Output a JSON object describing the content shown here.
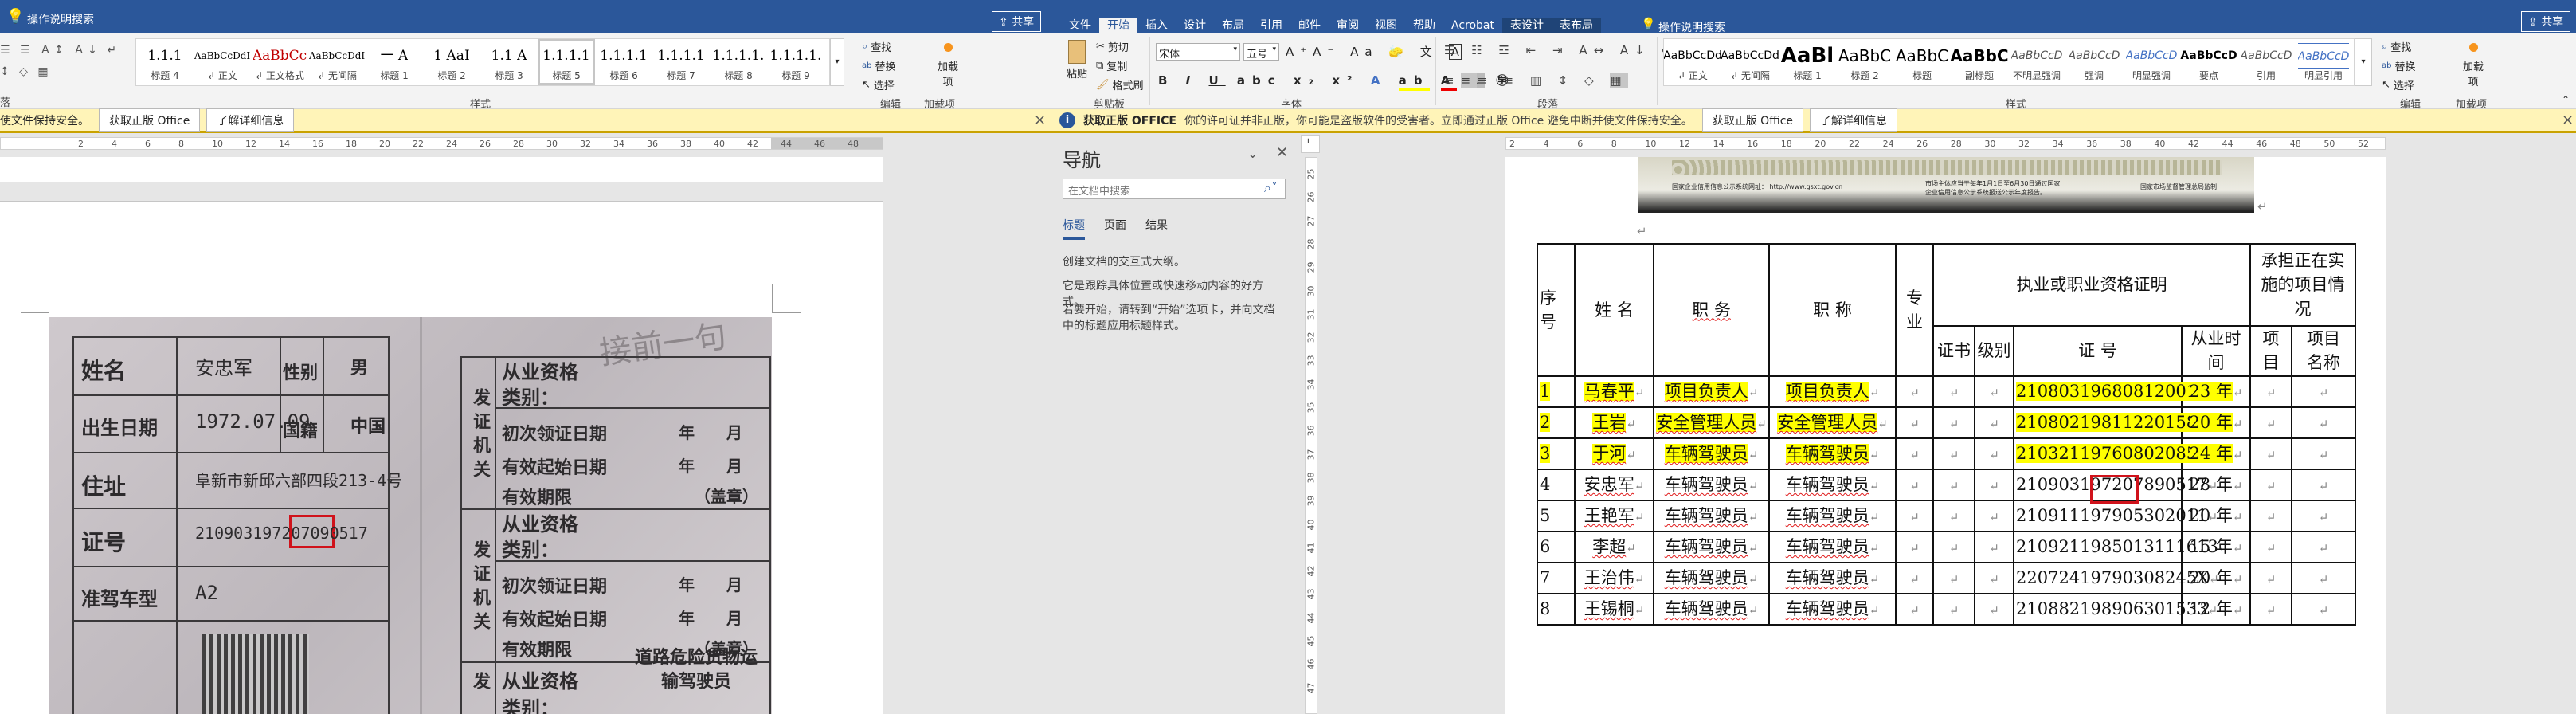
{
  "left_window": {
    "search_label": "操作说明搜索",
    "share_label": "共享",
    "paragraph_group_label": "落",
    "styles": [
      {
        "preview": "1.1.1",
        "label": "标题 4"
      },
      {
        "preview": "AaBbCcDdI",
        "label": "↲ 正文"
      },
      {
        "preview": "AaBbCc",
        "label": "↲ 正文格式"
      },
      {
        "preview": "AaBbCcDdI",
        "label": "↲ 无间隔"
      },
      {
        "preview": "一  A",
        "label": "标题 1"
      },
      {
        "preview": "1  AaI",
        "label": "标题 2"
      },
      {
        "preview": "1.1  A",
        "label": "标题 3"
      },
      {
        "preview": "1.1.1.1",
        "label": "标题 5"
      },
      {
        "preview": "1.1.1.1",
        "label": "标题 6"
      },
      {
        "preview": "1.1.1.1",
        "label": "标题 7"
      },
      {
        "preview": "1.1.1.1.",
        "label": "标题 8"
      },
      {
        "preview": "1.1.1.1.",
        "label": "标题 9"
      }
    ],
    "selected_style": "标题 5",
    "styles_group_label": "样式",
    "editing": {
      "find": "查找",
      "replace": "替换",
      "select": "选择",
      "label": "编辑"
    },
    "addins": {
      "button": "加载项",
      "label": "加载项"
    },
    "infobar": {
      "message_tail": "使文件保持安全。",
      "get_button": "获取正版 Office",
      "learn_button": "了解详细信息",
      "close": "×"
    },
    "ruler_labels": [
      "2",
      "4",
      "6",
      "8",
      "10",
      "12",
      "14",
      "16",
      "18",
      "20",
      "22",
      "24",
      "26",
      "28",
      "30",
      "32",
      "34",
      "36",
      "38",
      "40",
      "42",
      "44",
      "46",
      "48"
    ],
    "photo": {
      "left_rows": [
        {
          "label": "姓名",
          "value": "安忠军",
          "extra_label": "性别",
          "extra_value": "男"
        },
        {
          "label": "出生日期",
          "value": "1972.07.09",
          "extra_label": "国籍",
          "extra_value": "中国"
        },
        {
          "label": "住址",
          "value": "阜新市新邱六部四段213-4号"
        },
        {
          "label": "证号",
          "value": "210903197207090517"
        },
        {
          "label": "准驾车型",
          "value": "A2"
        }
      ],
      "right_blocks": [
        {
          "issuer": "发证机关",
          "category": "从业资格\n类别：",
          "first_date": "初次领证日期",
          "start_date": "有效起始日期",
          "valid": "有效期限",
          "seal": "（盖章）",
          "ymd": "年　　月　　日"
        },
        {
          "issuer": "发证机关",
          "category": "从业资格\n类别：",
          "first_date": "初次领证日期",
          "start_date": "有效起始日期",
          "valid": "有效期限",
          "seal": "（盖章）",
          "ymd": "年　　月　　日"
        }
      ],
      "third_category": "从业资格\n类别：",
      "third_value": "道路危险货物运\n输驾驶员",
      "handwriting": "接前一句"
    }
  },
  "right_window": {
    "tabs": [
      "文件",
      "开始",
      "插入",
      "设计",
      "布局",
      "引用",
      "邮件",
      "审阅",
      "视图",
      "帮助",
      "Acrobat",
      "表设计",
      "表布局"
    ],
    "active_tab": "开始",
    "search_label": "操作说明搜索",
    "share_label": "共享",
    "clipboard": {
      "paste": "粘贴",
      "cut": "剪切",
      "copy": "复制",
      "format_painter": "格式刷",
      "label": "剪贴板"
    },
    "font": {
      "name": "宋体",
      "size": "五号",
      "label": "字体"
    },
    "paragraph_label": "段落",
    "styles": [
      {
        "preview": "AaBbCcDd",
        "label": "↲ 正文"
      },
      {
        "preview": "AaBbCcDd",
        "label": "↲ 无间隔"
      },
      {
        "preview": "AaBl",
        "label": "标题 1"
      },
      {
        "preview": "AaBbC",
        "label": "标题 2"
      },
      {
        "preview": "AaBbC",
        "label": "标题"
      },
      {
        "preview": "AaBbC",
        "label": "副标题"
      },
      {
        "preview": "AaBbCcD",
        "label": "不明显强调"
      },
      {
        "preview": "AaBbCcD",
        "label": "强调"
      },
      {
        "preview": "AaBbCcD",
        "label": "明显强调"
      },
      {
        "preview": "AaBbCcD",
        "label": "要点"
      },
      {
        "preview": "AaBbCcD",
        "label": "引用"
      },
      {
        "preview": "AaBbCcD",
        "label": "明显引用"
      }
    ],
    "styles_group_label": "样式",
    "editing": {
      "find": "查找",
      "replace": "替换",
      "select": "选择",
      "label": "编辑"
    },
    "addins": {
      "button": "加载项",
      "label": "加载项"
    },
    "infobar": {
      "title": "获取正版 OFFICE",
      "message": "你的许可证并非正版，你可能是盗版软件的受害者。立即通过正版 Office 避免中断并使文件保持安全。",
      "get_button": "获取正版 Office",
      "learn_button": "了解详细信息",
      "close": "×"
    },
    "nav": {
      "title": "导航",
      "search_placeholder": "在文档中搜索",
      "tabs": [
        "标题",
        "页面",
        "结果"
      ],
      "active_tab": "标题",
      "p1": "创建文档的交互式大纲。",
      "p2": "它是跟踪具体位置或快速移动内容的好方式。",
      "p3": "若要开始，请转到“开始”选项卡，并向文档中的标题应用标题样式。"
    },
    "ruler_labels": [
      "2",
      "4",
      "6",
      "8",
      "10",
      "12",
      "14",
      "16",
      "18",
      "20",
      "22",
      "24",
      "26",
      "28",
      "30",
      "32",
      "34",
      "36",
      "38",
      "40",
      "42",
      "44",
      "46",
      "48",
      "50",
      "52"
    ],
    "vruler_labels": [
      "25",
      "26",
      "27",
      "28",
      "29",
      "30",
      "31",
      "32",
      "33",
      "34",
      "35",
      "36",
      "37",
      "38",
      "39",
      "40",
      "41",
      "42",
      "43",
      "44",
      "45",
      "46",
      "47"
    ],
    "image_caption": {
      "left": "国家企业信用信息公示系统网址：  http://www.gsxt.gov.cn",
      "middle": "市场主体应当于每年1月1日至6月30日通过国家企业信用信息公示系统报送公示年度报告。",
      "right": "国家市场监督管理总局监制"
    },
    "table": {
      "headers": {
        "seq": "序号",
        "name": "姓 名",
        "duty": "职 务",
        "title": "职 称",
        "major": "专业",
        "cert_group": "执业或职业资格证明",
        "project_group": "承担正在实施的项目情况",
        "cert": "证书",
        "level": "级别",
        "cert_no": "证 号",
        "years": "从业时间",
        "project": "项目",
        "project_name": "项目名称"
      },
      "rows": [
        {
          "seq": "1",
          "name": "马春平",
          "duty": "项目负责人",
          "title": "项目负责人",
          "cert_no": "210803196808120013",
          "years": "23 年",
          "highlight": true
        },
        {
          "seq": "2",
          "name": "王岩",
          "duty": "安全管理人员",
          "title": "安全管理人员",
          "cert_no": "21080219811220158X",
          "years": "20 年",
          "highlight": true
        },
        {
          "seq": "3",
          "name": "于河",
          "duty": "车辆驾驶员",
          "title": "车辆驾驶员",
          "cert_no": "210321197608020851",
          "years": "24 年",
          "highlight": true
        },
        {
          "seq": "4",
          "name": "安忠军",
          "duty": "车辆驾驶员",
          "title": "车辆驾驶员",
          "cert_no": "210903197207890517",
          "years": "28 年",
          "highlight": false
        },
        {
          "seq": "5",
          "name": "王艳军",
          "duty": "车辆驾驶员",
          "title": "车辆驾驶员",
          "cert_no": "210911197905302011",
          "years": "20 年",
          "highlight": false
        },
        {
          "seq": "6",
          "name": "李超",
          "duty": "车辆驾驶员",
          "title": "车辆驾驶员",
          "cert_no": "2109211985013111613",
          "years": "15 年",
          "highlight": false
        },
        {
          "seq": "7",
          "name": "王治伟",
          "duty": "车辆驾驶员",
          "title": "车辆驾驶员",
          "cert_no": "22072419790308245X",
          "years": "20 年",
          "highlight": false
        },
        {
          "seq": "8",
          "name": "王锡桐",
          "duty": "车辆驾驶员",
          "title": "车辆驾驶员",
          "cert_no": "210882198906301533",
          "years": "12 年",
          "highlight": false
        }
      ],
      "return_mark": "↵"
    }
  },
  "colors": {
    "title_bar": "#2b579a",
    "highlight": "#ffff00",
    "annotation_box": "#d0121b",
    "infobar": "#fff4b8"
  }
}
